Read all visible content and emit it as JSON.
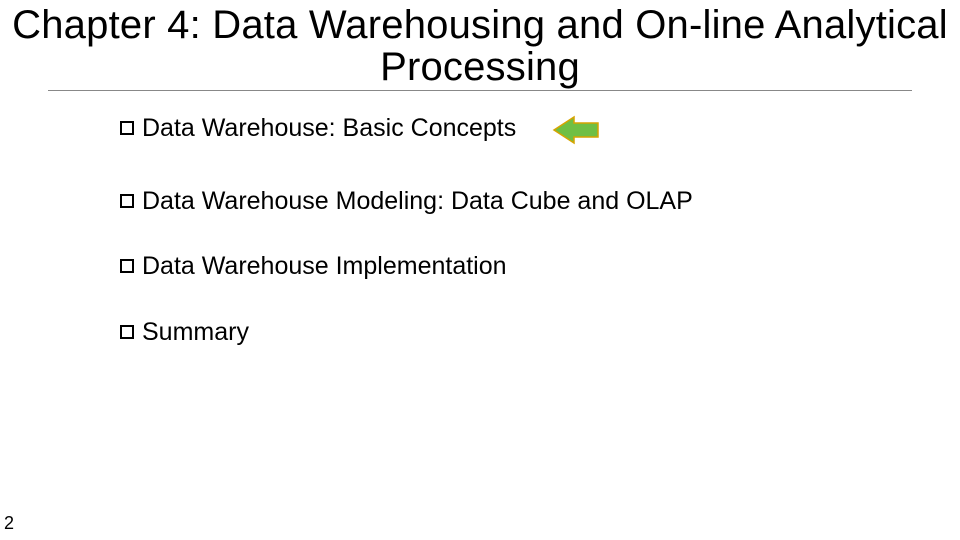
{
  "title": "Chapter 4: Data Warehousing and On-line Analytical Processing",
  "items": [
    {
      "label": "Data Warehouse: Basic Concepts",
      "highlighted": true
    },
    {
      "label": "Data Warehouse Modeling: Data Cube and OLAP",
      "highlighted": false
    },
    {
      "label": "Data Warehouse Implementation",
      "highlighted": false
    },
    {
      "label": "Summary",
      "highlighted": false
    }
  ],
  "page_number": "2",
  "colors": {
    "arrow_fill": "#6fbf44",
    "arrow_stroke": "#d6a400"
  }
}
